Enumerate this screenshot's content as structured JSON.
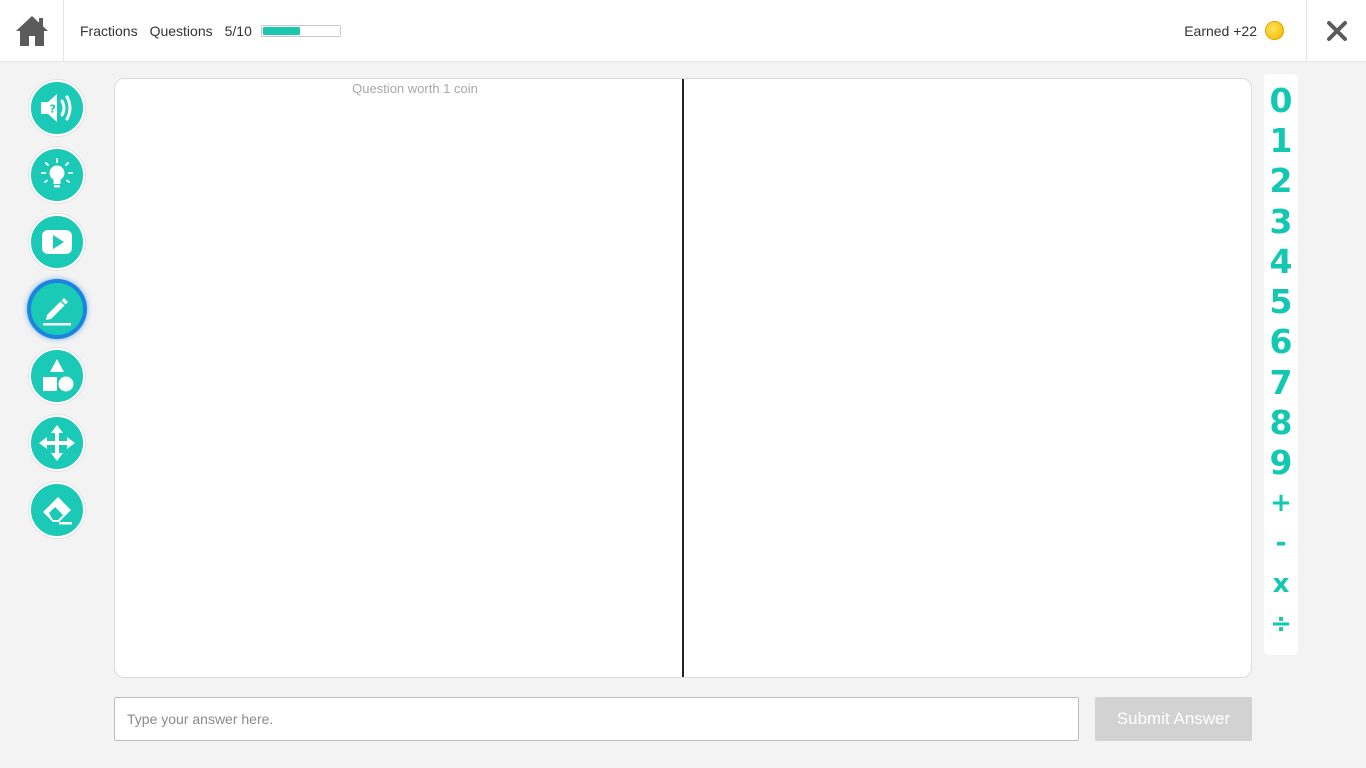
{
  "topbar": {
    "home_icon": "home-icon",
    "topic": "Fractions",
    "questions_label": "Questions",
    "questions_count": "5/10",
    "progress_fraction": 0.5,
    "earned_label": "Earned +22",
    "coin_icon": "coin-icon",
    "close_icon": "close-icon"
  },
  "tools": [
    {
      "icon": "audio-question-icon"
    },
    {
      "icon": "lightbulb-icon"
    },
    {
      "icon": "video-play-icon"
    },
    {
      "icon": "pencil-icon",
      "active": true
    },
    {
      "icon": "shapes-icon"
    },
    {
      "icon": "move-arrows-icon"
    },
    {
      "icon": "eraser-icon"
    }
  ],
  "canvas": {
    "worth_text": "Question worth 1 coin"
  },
  "numpad": {
    "keys": [
      "0",
      "1",
      "2",
      "3",
      "4",
      "5",
      "6",
      "7",
      "8",
      "9",
      "+",
      "-",
      "x",
      "÷"
    ]
  },
  "answer": {
    "placeholder": "Type your answer here.",
    "value": "",
    "submit_label": "Submit Answer"
  },
  "colors": {
    "accent": "#1ac9b6",
    "active_ring": "#1a84e0",
    "submit_disabled": "#d2d2d2"
  }
}
